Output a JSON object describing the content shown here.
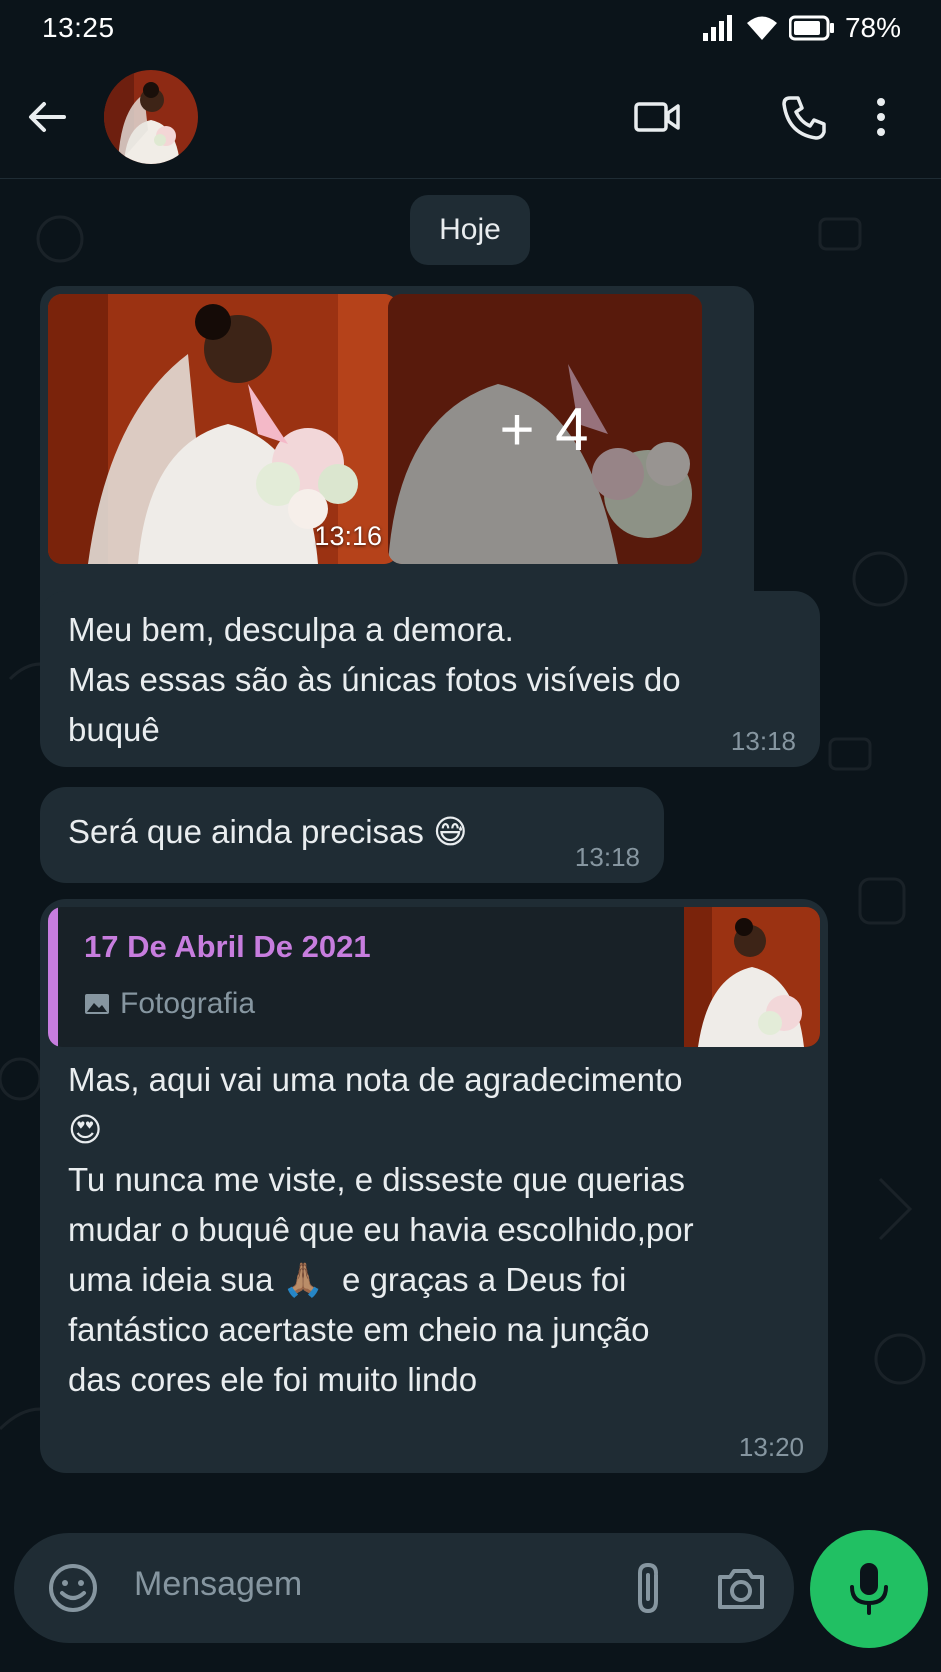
{
  "status_bar": {
    "time": "13:25",
    "battery": "78%"
  },
  "header": {
    "avatar_alt": "bride-photo",
    "icons": [
      "back-arrow-icon",
      "video-call-icon",
      "phone-call-icon",
      "more-options-icon"
    ]
  },
  "chat": {
    "date_chip": "Hoje",
    "photo_group": {
      "time": "13:16",
      "more_count": "+ 4"
    },
    "messages": [
      {
        "text": "Meu bem, desculpa a demora.\nMas essas são às únicas fotos visíveis do\nbuquê",
        "time": "13:18"
      },
      {
        "text": "Será que ainda precisas 😅",
        "time": "13:18"
      },
      {
        "quote_author": "17 De Abril De 2021",
        "quote_type": "Fotografia",
        "text": "Mas, aqui vai uma nota de agradecimento\n😍\nTu nunca me viste, e disseste que querias\nmudar o buquê que eu havia escolhido,por\numa ideia sua 🙏🏽  e graças a Deus foi\nfantástico acertaste em cheio na junção\ndas cores ele foi muito lindo",
        "time": "13:20"
      }
    ]
  },
  "input": {
    "placeholder": "Mensagem"
  },
  "colors": {
    "background": "#0b141a",
    "bubble": "#1f2c34",
    "accent_green": "#21c063",
    "quote_accent": "#c77dde",
    "muted": "#8696a0"
  }
}
